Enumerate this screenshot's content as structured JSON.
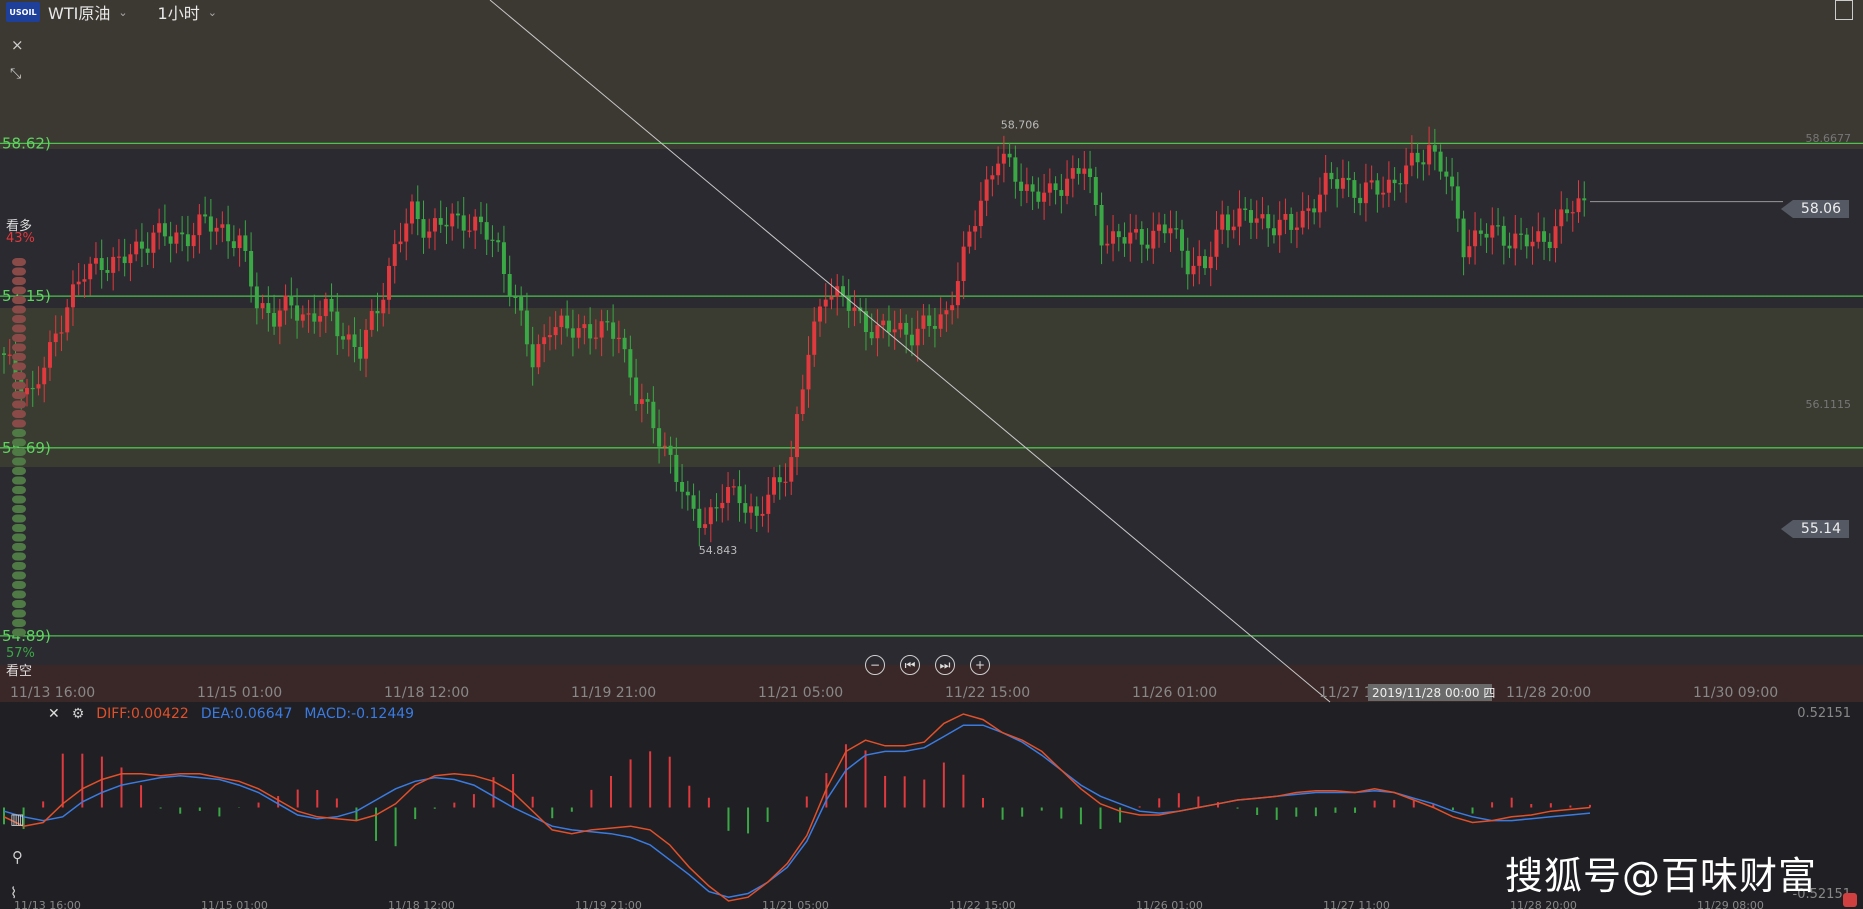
{
  "header": {
    "logo_text": "USOIL",
    "symbol_label": "WTI原油",
    "interval_label": "1小时"
  },
  "sentiment": {
    "bull_label": "看多",
    "bull_pct": "43%",
    "bear_label": "看空",
    "bear_pct": "57%"
  },
  "macd_legend": {
    "diff": "DIFF:0.00422",
    "dea": "DEA:0.06647",
    "macd": "MACD:-0.12449"
  },
  "price_tags": {
    "current": "58.06",
    "lower": "55.14"
  },
  "watermark": "搜狐号@百味财富",
  "cursor_time": "2019/11/28 00:00 四",
  "colors": {
    "up": "#e0393e",
    "down": "#3aa845",
    "grid_line": "#4ec24e",
    "diff_line": "#e0502a",
    "dea_line": "#3b7be0",
    "background": "#2a2a30"
  },
  "chart_data": {
    "type": "candlestick",
    "title": "WTI原油 1小时",
    "price_levels": [
      {
        "label": "58.62)",
        "value": 58.62
      },
      {
        "label": "57.15)",
        "value": 57.15
      },
      {
        "label": "55.69)",
        "value": 55.69
      },
      {
        "label": "54.89)",
        "value": 53.88
      }
    ],
    "right_axis_labels": [
      "58.6677",
      "56.1115"
    ],
    "annotations": [
      {
        "label": "58.706",
        "value": 58.706
      },
      {
        "label": "54.843",
        "value": 54.843
      }
    ],
    "x_tick_labels": [
      "11/13 16:00",
      "11/15 01:00",
      "11/18 12:00",
      "11/19 21:00",
      "11/21 05:00",
      "11/22 15:00",
      "11/26 01:00",
      "11/27 1",
      "11/28 20:00",
      "11/30 09:00"
    ],
    "ylim": [
      53.6,
      60.0
    ],
    "close_path": [
      56.6,
      56.4,
      56.2,
      56.6,
      57.1,
      57.35,
      57.5,
      57.45,
      57.6,
      57.75,
      57.7,
      57.75,
      57.85,
      57.8,
      57.65,
      57.1,
      56.95,
      57.05,
      56.95,
      57.0,
      56.8,
      56.6,
      57.05,
      57.6,
      57.95,
      57.8,
      57.85,
      57.9,
      57.8,
      57.6,
      57.1,
      56.5,
      56.9,
      56.8,
      56.85,
      56.8,
      56.8,
      56.2,
      55.9,
      55.6,
      55.1,
      55.0,
      55.2,
      55.25,
      55.0,
      55.3,
      55.6,
      56.6,
      57.25,
      57.1,
      56.95,
      56.8,
      56.85,
      56.8,
      56.85,
      57.0,
      57.5,
      58.1,
      58.5,
      58.3,
      58.15,
      58.1,
      58.3,
      58.4,
      57.75,
      57.7,
      57.7,
      57.75,
      57.8,
      57.5,
      57.4,
      57.9,
      57.9,
      57.9,
      57.85,
      57.8,
      58.0,
      58.2,
      58.3,
      58.1,
      58.2,
      58.25,
      58.4,
      58.6,
      58.3,
      57.65,
      57.75,
      57.75,
      57.7,
      57.65,
      57.75,
      57.95,
      58.06
    ],
    "macd": {
      "diff_label": "DIFF:0.00422",
      "dea_label": "DEA:0.06647",
      "macd_label": "MACD:-0.12449",
      "ylim": [
        -0.52151,
        0.52151
      ],
      "y_axis_labels": [
        "0.52151",
        "-0.52151"
      ],
      "x_tick_labels": [
        "11/13 16:00",
        "11/15 01:00",
        "11/18 12:00",
        "11/19 21:00",
        "11/21 05:00",
        "11/22 15:00",
        "11/26 01:00",
        "11/27 11:00",
        "11/28 20:00",
        "11/29 08:00"
      ],
      "diff": [
        -0.05,
        -0.1,
        -0.08,
        0.02,
        0.1,
        0.15,
        0.18,
        0.18,
        0.17,
        0.18,
        0.18,
        0.16,
        0.14,
        0.1,
        0.04,
        -0.02,
        -0.05,
        -0.06,
        -0.07,
        -0.04,
        0.02,
        0.12,
        0.17,
        0.18,
        0.17,
        0.14,
        0.08,
        -0.02,
        -0.12,
        -0.14,
        -0.12,
        -0.11,
        -0.1,
        -0.12,
        -0.2,
        -0.32,
        -0.42,
        -0.5,
        -0.48,
        -0.4,
        -0.3,
        -0.15,
        0.1,
        0.3,
        0.36,
        0.33,
        0.33,
        0.35,
        0.45,
        0.5,
        0.47,
        0.4,
        0.36,
        0.3,
        0.2,
        0.1,
        0.02,
        -0.02,
        -0.04,
        -0.04,
        -0.02,
        0.0,
        0.02,
        0.04,
        0.05,
        0.06,
        0.08,
        0.09,
        0.09,
        0.08,
        0.1,
        0.08,
        0.04,
        0.0,
        -0.05,
        -0.08,
        -0.07,
        -0.05,
        -0.04,
        -0.02,
        -0.01,
        0.0
      ],
      "dea": [
        -0.02,
        -0.05,
        -0.07,
        -0.05,
        0.03,
        0.08,
        0.12,
        0.14,
        0.16,
        0.17,
        0.16,
        0.15,
        0.12,
        0.08,
        0.02,
        -0.04,
        -0.06,
        -0.05,
        -0.02,
        0.04,
        0.1,
        0.14,
        0.16,
        0.15,
        0.12,
        0.06,
        0.0,
        -0.05,
        -0.1,
        -0.12,
        -0.13,
        -0.14,
        -0.16,
        -0.2,
        -0.28,
        -0.36,
        -0.45,
        -0.48,
        -0.46,
        -0.4,
        -0.32,
        -0.18,
        0.04,
        0.2,
        0.28,
        0.3,
        0.3,
        0.32,
        0.38,
        0.44,
        0.44,
        0.4,
        0.35,
        0.28,
        0.2,
        0.12,
        0.06,
        0.02,
        -0.02,
        -0.03,
        -0.02,
        0.0,
        0.02,
        0.04,
        0.05,
        0.06,
        0.07,
        0.08,
        0.08,
        0.08,
        0.09,
        0.08,
        0.05,
        0.02,
        -0.02,
        -0.05,
        -0.07,
        -0.07,
        -0.06,
        -0.05,
        -0.04,
        -0.03
      ]
    }
  }
}
